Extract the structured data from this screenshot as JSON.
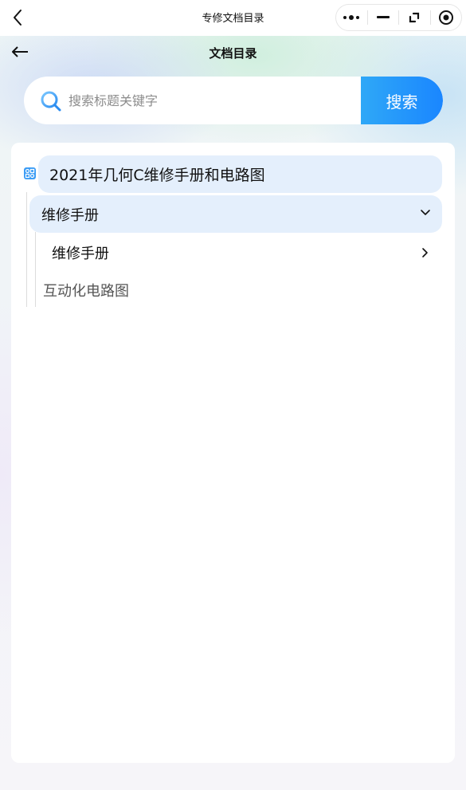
{
  "topbar": {
    "title": "专修文档目录",
    "back_icon": "chevron-left-icon",
    "capsule_icons": [
      "more-dots-icon",
      "minimize-icon",
      "restore-icon",
      "close-target-icon"
    ]
  },
  "header": {
    "title": "文档目录",
    "back_icon": "arrow-left-icon"
  },
  "search": {
    "placeholder": "搜索标题关键字",
    "value": "",
    "button_label": "搜索"
  },
  "tree": {
    "root": {
      "label": "2021年几何C维修手册和电路图",
      "icon": "tree-node-icon"
    },
    "children": [
      {
        "label": "维修手册",
        "expanded": true,
        "children": [
          {
            "label": "维修手册"
          }
        ]
      },
      {
        "label": "互动化电路图"
      }
    ]
  },
  "colors": {
    "accent": "#1a86ff",
    "node_highlight": "#e4effc"
  }
}
